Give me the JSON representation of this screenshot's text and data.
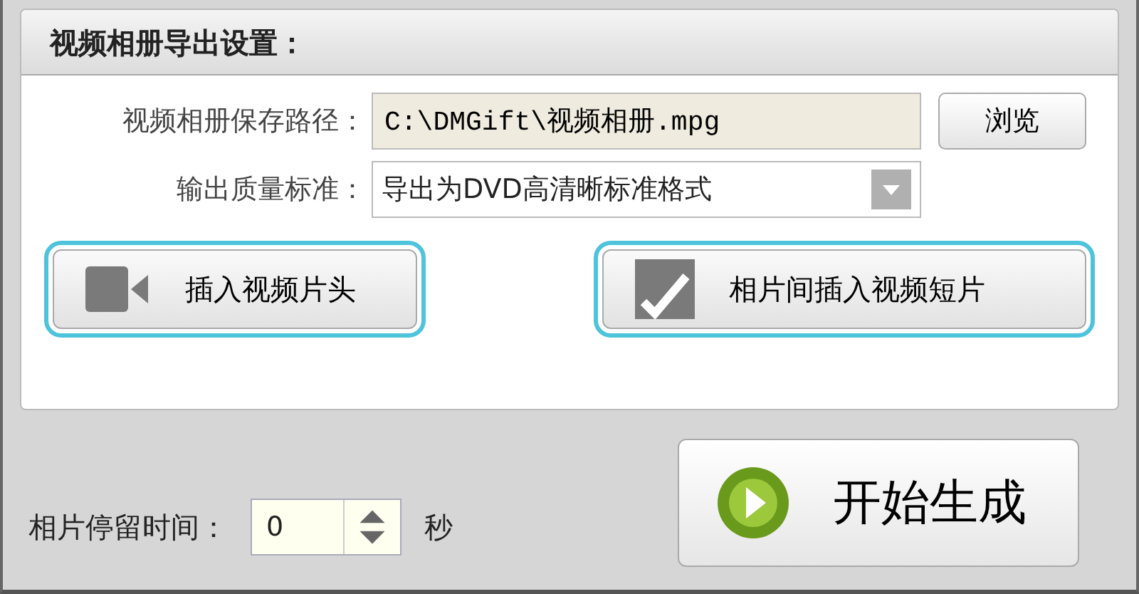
{
  "panel": {
    "title": "视频相册导出设置：",
    "save_path": {
      "label": "视频相册保存路径：",
      "value": "C:\\DMGift\\视频相册.mpg",
      "browse_button": "浏览"
    },
    "quality": {
      "label": "输出质量标准：",
      "value": "导出为DVD高清晰标准格式"
    },
    "buttons": [
      {
        "kind": "camera",
        "label": "插入视频片头",
        "highlighted": true
      },
      {
        "kind": "check",
        "label": "相片间插入视频短片",
        "highlighted": true
      }
    ]
  },
  "duration": {
    "label": "相片停留时间：",
    "value": "0",
    "unit": "秒"
  },
  "start_button": {
    "label": "开始生成"
  }
}
